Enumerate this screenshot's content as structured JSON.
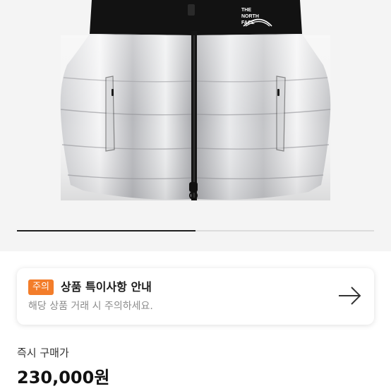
{
  "product": {
    "image_brand_text": [
      "THE",
      "NORTH",
      "FACE"
    ],
    "image_name": "silver-puffer-vest",
    "carousel": {
      "current": 1,
      "total": 2
    }
  },
  "notice": {
    "badge": "주의",
    "title": "상품 특이사항 안내",
    "description": "해당 상품 거래 시 주의하세요.",
    "icon": "arrow-right-icon"
  },
  "purchase": {
    "label": "즉시 구매가",
    "price": "230,000원"
  },
  "colors": {
    "accent": "#f37d2a",
    "hero_background": "#f4f4f4"
  }
}
